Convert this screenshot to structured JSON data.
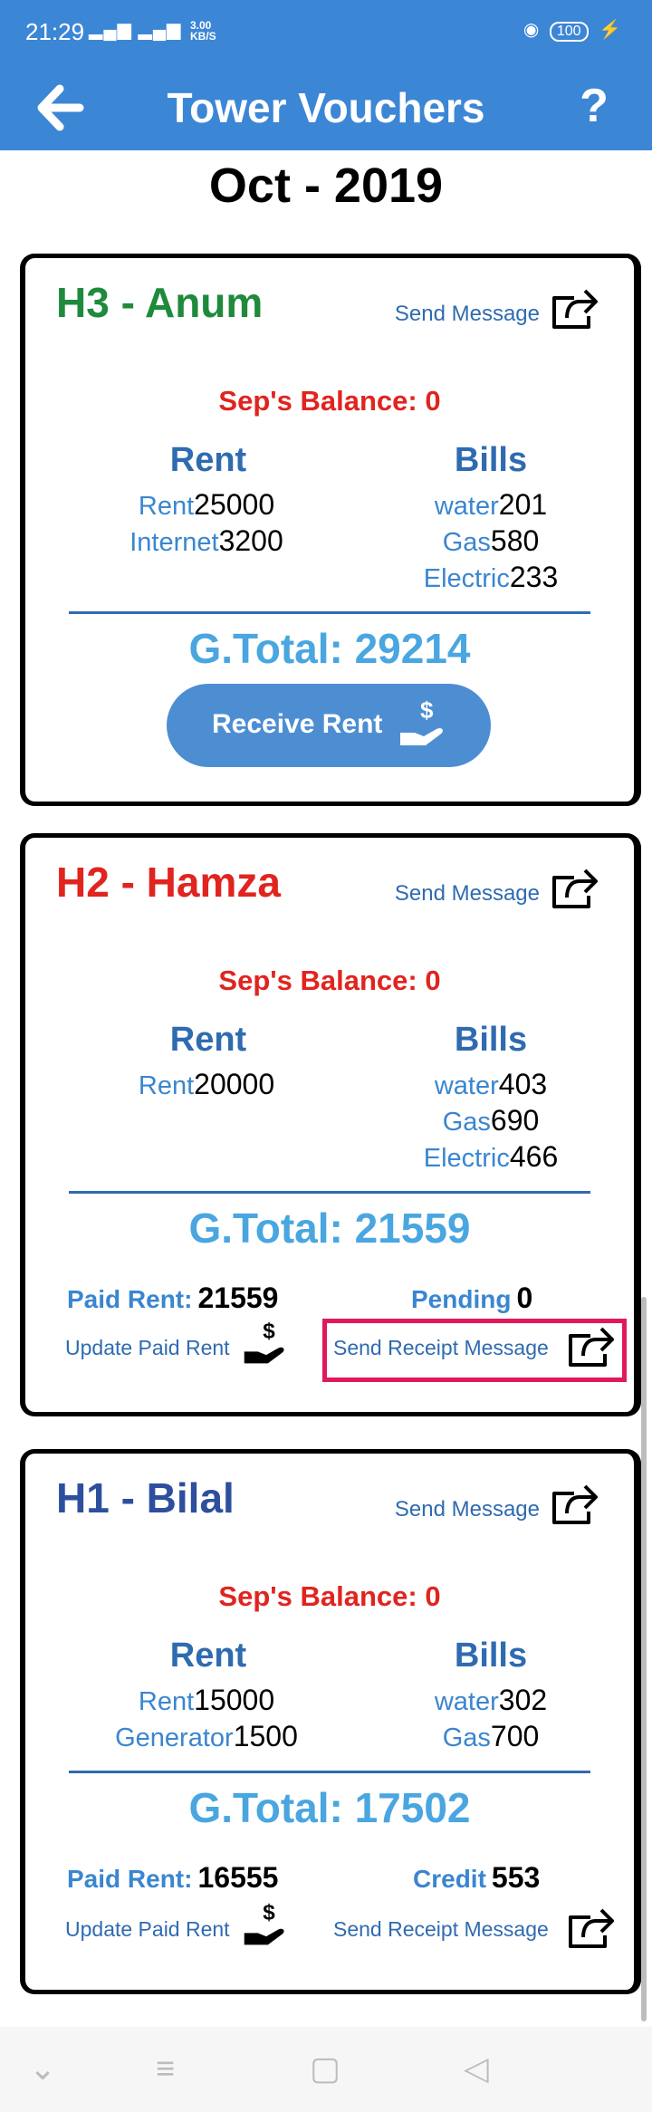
{
  "status": {
    "time": "21:29",
    "signal": "▂▄▆ ▂▄▆",
    "net_rate": "3.00",
    "net_unit": "KB/S",
    "battery": "100"
  },
  "app": {
    "title": "Tower Vouchers",
    "back_glyph": "🡐",
    "help_glyph": "?"
  },
  "month": "Oct - 2019",
  "cards": [
    {
      "name": "H3 - Anum",
      "name_color": "#1e8a3c",
      "send_message": "Send Message",
      "balance": "Sep's Balance: 0",
      "rent_head": "Rent",
      "bills_head": "Bills",
      "rent_items": [
        {
          "label": "Rent",
          "value": "25000"
        },
        {
          "label": "Internet",
          "value": "3200"
        }
      ],
      "bill_items": [
        {
          "label": "water",
          "value": "201"
        },
        {
          "label": "Gas",
          "value": "580"
        },
        {
          "label": "Electric",
          "value": "233"
        }
      ],
      "gtotal": "G.Total: 29214",
      "receive_button": "Receive Rent"
    },
    {
      "name": "H2 - Hamza",
      "name_color": "#e0241f",
      "send_message": "Send Message",
      "balance": "Sep's Balance: 0",
      "rent_head": "Rent",
      "bills_head": "Bills",
      "rent_items": [
        {
          "label": "Rent",
          "value": "20000"
        }
      ],
      "bill_items": [
        {
          "label": "water",
          "value": "403"
        },
        {
          "label": "Gas",
          "value": "690"
        },
        {
          "label": "Electric",
          "value": "466"
        }
      ],
      "gtotal": "G.Total: 21559",
      "paid_label": "Paid Rent:",
      "paid_value": "21559",
      "status_label": "Pending",
      "status_value": "0",
      "update_link": "Update Paid Rent",
      "receipt_link": "Send Receipt Message"
    },
    {
      "name": "H1 - Bilal",
      "name_color": "#2d4f9e",
      "send_message": "Send Message",
      "balance": "Sep's Balance: 0",
      "rent_head": "Rent",
      "bills_head": "Bills",
      "rent_items": [
        {
          "label": "Rent",
          "value": "15000"
        },
        {
          "label": "Generator",
          "value": "1500"
        }
      ],
      "bill_items": [
        {
          "label": "water",
          "value": "302"
        },
        {
          "label": "Gas",
          "value": "700"
        }
      ],
      "gtotal": "G.Total: 17502",
      "paid_label": "Paid Rent:",
      "paid_value": "16555",
      "status_label": "Credit",
      "status_value": "553",
      "update_link": "Update Paid Rent",
      "receipt_link": "Send Receipt Message"
    }
  ],
  "nav": {
    "down_glyph": "⌄",
    "menu_glyph": "≡",
    "home_glyph": "▢",
    "back_glyph": "◁"
  }
}
